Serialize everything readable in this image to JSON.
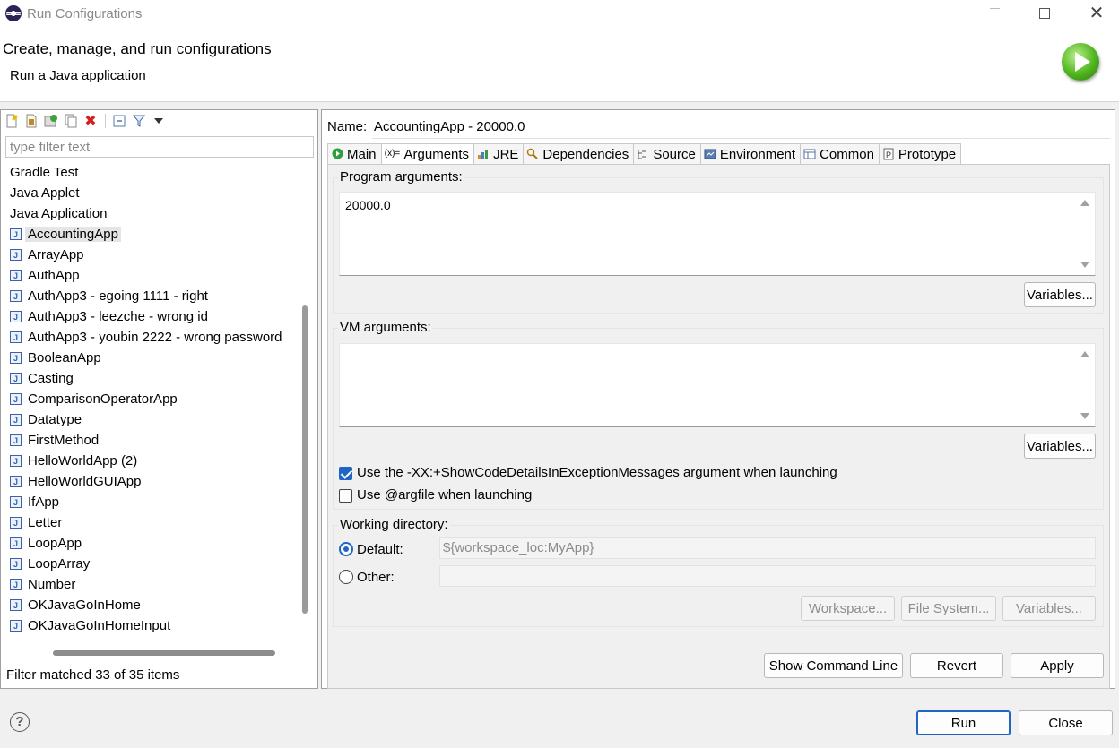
{
  "window": {
    "title": "Run Configurations"
  },
  "header": {
    "title": "Create, manage, and run configurations",
    "subtitle": "Run a Java application"
  },
  "left": {
    "filter_placeholder": "type filter text",
    "categories": [
      "Gradle Test",
      "Java Applet",
      "Java Application"
    ],
    "configs": [
      "AccountingApp",
      "ArrayApp",
      "AuthApp",
      "AuthApp3 - egoing 1111 - right",
      "AuthApp3 - leezche - wrong id",
      "AuthApp3 - youbin 2222 - wrong password",
      "BooleanApp",
      "Casting",
      "ComparisonOperatorApp",
      "Datatype",
      "FirstMethod",
      "HelloWorldApp (2)",
      "HelloWorldGUIApp",
      "IfApp",
      "Letter",
      "LoopApp",
      "LoopArray",
      "Number",
      "OKJavaGoInHome",
      "OKJavaGoInHomeInput"
    ],
    "selected": "AccountingApp",
    "status": "Filter matched 33 of 35 items"
  },
  "right": {
    "name_label": "Name:",
    "name_value": "AccountingApp - 20000.0",
    "tabs": [
      "Main",
      "Arguments",
      "JRE",
      "Dependencies",
      "Source",
      "Environment",
      "Common",
      "Prototype"
    ],
    "active_tab": "Arguments",
    "program_args_label": "Program arguments:",
    "program_args_value": "20000.0",
    "vm_args_label": "VM arguments:",
    "vm_args_value": "",
    "variables_label": "Variables...",
    "show_code_details_label": "Use the -XX:+ShowCodeDetailsInExceptionMessages argument when launching",
    "show_code_details_checked": true,
    "argfile_label": "Use @argfile when launching",
    "argfile_checked": false,
    "working_dir_label": "Working directory:",
    "default_label": "Default:",
    "default_value": "${workspace_loc:MyApp}",
    "other_label": "Other:",
    "workspace_btn": "Workspace...",
    "filesystem_btn": "File System...",
    "variables_btn": "Variables...",
    "show_cmd_btn": "Show Command Line",
    "revert_btn": "Revert",
    "apply_btn": "Apply"
  },
  "footer": {
    "run_btn": "Run",
    "close_btn": "Close"
  },
  "colors": {
    "accent": "#1f66c4",
    "run_green": "#4fb41d"
  }
}
